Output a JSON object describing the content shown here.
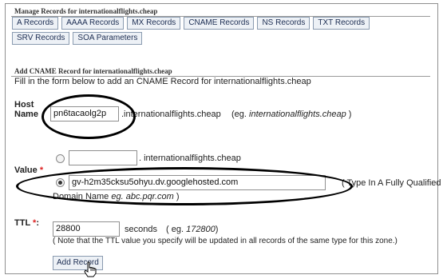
{
  "manage": {
    "title": "Manage Records for internationalflights.cheap",
    "tabs": [
      "A Records",
      "AAAA Records",
      "MX Records",
      "CNAME Records",
      "NS Records",
      "TXT Records",
      "SRV Records",
      "SOA Parameters"
    ]
  },
  "add": {
    "title": "Add CNAME Record for internationalflights.cheap",
    "intro": "Fill in the form below to add an CNAME Record for internationalflights.cheap"
  },
  "host": {
    "label_line1": "Host",
    "label_line2": "Name",
    "value": "pn6tacaolg2p",
    "suffix": ".internationalflights.cheap",
    "example_prefix": "(eg.",
    "example_domain": "internationalflights.cheap",
    "example_suffix": ")"
  },
  "value": {
    "label": "Value",
    "required_mark": "*",
    "option1_value": "",
    "option1_suffix": ". internationalflights.cheap",
    "option2_value": "gv-h2m35cksu5ohyu.dv.googlehosted.com",
    "hint_a": "( Type In A Fully Qualified",
    "hint_b_prefix": "Domain Name",
    "hint_b_example": "eg. abc.pqr.com",
    "hint_b_suffix": ")",
    "selected_option": 2
  },
  "ttl": {
    "label": "TTL",
    "required_mark": "*",
    "colon": ":",
    "value": "28800",
    "unit": "seconds",
    "example_prefix": "( eg.",
    "example_value": "172800",
    "example_suffix": ")",
    "note": "( Note that the TTL value you specify will be updated in all records of the same type for this zone.)"
  },
  "submit_label": "Add Record"
}
